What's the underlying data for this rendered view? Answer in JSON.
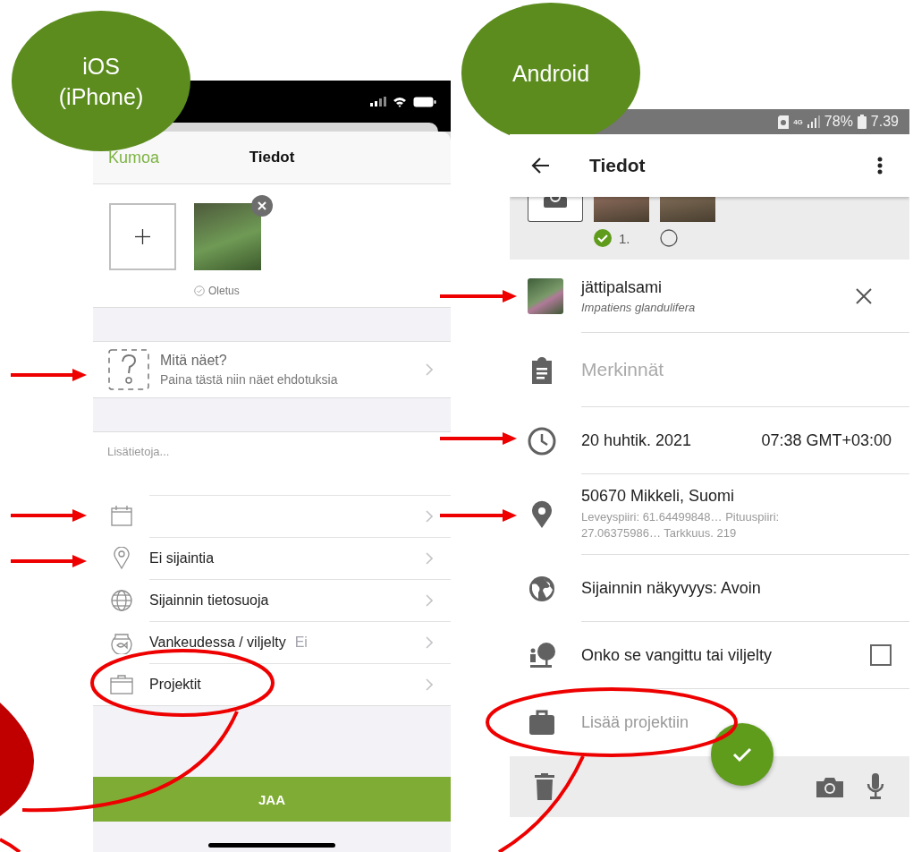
{
  "badges": [
    {
      "kind": "ios",
      "text": "iOS (iPhone)"
    },
    {
      "kind": "android",
      "text": "Android"
    }
  ],
  "ios": {
    "header": {
      "cancel": "Kumoa",
      "title": "Tiedot"
    },
    "photo": {
      "default_label": "Oletus"
    },
    "identify": {
      "title": "Mitä näet?",
      "subtitle": "Paina tästä niin näet ehdotuksia"
    },
    "notes": {
      "placeholder": "Lisätietoja..."
    },
    "rows": [
      {
        "kind": "calendar"
      },
      {
        "kind": "location",
        "label": "Ei sijaintia"
      },
      {
        "kind": "privacy",
        "label": "Sijainnin tietosuoja"
      },
      {
        "kind": "captive",
        "label": "Vankeudessa / viljelty",
        "value": "Ei"
      },
      {
        "kind": "projects",
        "label": "Projektit"
      }
    ],
    "share_button": "JAA"
  },
  "android": {
    "status_bar": {
      "network": "4G",
      "battery": "78%",
      "time": "7.39"
    },
    "toolbar": {
      "title": "Tiedot"
    },
    "photos": [
      {
        "selected": true,
        "label": "1."
      },
      {
        "selected": false
      }
    ],
    "species": {
      "name": "jättipalsami",
      "scientific_name": "Impatiens glandulifera"
    },
    "notes": {
      "placeholder": "Merkinnät"
    },
    "date": "20 huhtik. 2021",
    "time": "07:38 GMT+03:00",
    "location": {
      "place": "50670 Mikkeli, Suomi",
      "details": "Leveyspiiri: 61.64499848…  Pituuspiiri: 27.06375986…  Tarkkuus. 219"
    },
    "visibility": "Sijainnin näkyvyys: Avoin",
    "captive": {
      "label": "Onko se vangittu tai viljelty",
      "checked": false
    },
    "project": {
      "label": "Lisää projektiin"
    }
  }
}
